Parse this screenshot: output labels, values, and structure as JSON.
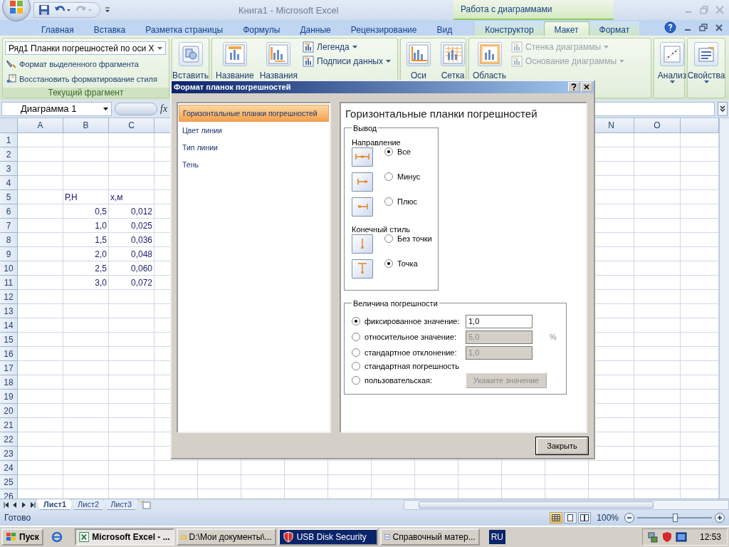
{
  "window": {
    "title": "Книга1 - Microsoft Excel",
    "context_group": "Работа с диаграммами"
  },
  "tabs": [
    {
      "label": "Главная",
      "selected": false,
      "contextual": false
    },
    {
      "label": "Вставка",
      "selected": false,
      "contextual": false
    },
    {
      "label": "Разметка страницы",
      "selected": false,
      "contextual": false
    },
    {
      "label": "Формулы",
      "selected": false,
      "contextual": false
    },
    {
      "label": "Данные",
      "selected": false,
      "contextual": false
    },
    {
      "label": "Рецензирование",
      "selected": false,
      "contextual": false
    },
    {
      "label": "Вид",
      "selected": false,
      "contextual": false
    },
    {
      "label": "Конструктор",
      "selected": false,
      "contextual": true
    },
    {
      "label": "Макет",
      "selected": true,
      "contextual": true
    },
    {
      "label": "Формат",
      "selected": false,
      "contextual": true
    }
  ],
  "ribbon": {
    "groups": [
      {
        "kind": "current",
        "selector": "Ряд1 Планки погрешностей по оси X",
        "commands": [
          "Формат выделенного фрагмента",
          "Восстановить форматирование стиля"
        ],
        "label": "Текущий фрагмент"
      },
      {
        "kind": "controls",
        "large": [
          {
            "label": "Вставить",
            "dropdown": false
          }
        ]
      },
      {
        "kind": "controls",
        "large": [
          {
            "label": "Название",
            "dropdown": false
          },
          {
            "label": "Названия",
            "dropdown": false
          }
        ],
        "small": [
          {
            "label": "Легенда",
            "dropdown": true,
            "disabled": false
          },
          {
            "label": "Подписи данных",
            "dropdown": true,
            "disabled": false
          }
        ]
      },
      {
        "kind": "controls",
        "large": [
          {
            "label": "Оси",
            "dropdown": false
          },
          {
            "label": "Сетка",
            "dropdown": false
          }
        ]
      },
      {
        "kind": "controls",
        "large": [
          {
            "label": "Область",
            "dropdown": false
          }
        ],
        "small": [
          {
            "label": "Стенка диаграммы",
            "dropdown": true,
            "disabled": true
          },
          {
            "label": "Основание диаграммы",
            "dropdown": true,
            "disabled": true
          }
        ]
      },
      {
        "kind": "controls",
        "large": [
          {
            "label": "Анализ",
            "dropdown": true
          }
        ]
      },
      {
        "kind": "controls",
        "large": [
          {
            "label": "Свойства",
            "dropdown": true
          }
        ]
      }
    ]
  },
  "formula_bar": {
    "name_box": "Диаграмма 1",
    "function_label": "fx"
  },
  "sheet": {
    "columns": [
      "A",
      "B",
      "C",
      "N",
      "O"
    ],
    "rows": [
      {
        "number": "1"
      },
      {
        "number": "2"
      },
      {
        "number": "3"
      },
      {
        "number": "4"
      },
      {
        "number": "5",
        "B": {
          "text": "Р,Н",
          "kind": "text"
        },
        "C": {
          "text": "х,м",
          "kind": "text"
        }
      },
      {
        "number": "6",
        "B": {
          "text": "0,5",
          "kind": "number"
        },
        "C": {
          "text": "0,012",
          "kind": "number"
        }
      },
      {
        "number": "7",
        "B": {
          "text": "1,0",
          "kind": "number"
        },
        "C": {
          "text": "0,025",
          "kind": "number"
        }
      },
      {
        "number": "8",
        "B": {
          "text": "1,5",
          "kind": "number"
        },
        "C": {
          "text": "0,036",
          "kind": "number"
        }
      },
      {
        "number": "9",
        "B": {
          "text": "2,0",
          "kind": "number"
        },
        "C": {
          "text": "0,048",
          "kind": "number"
        }
      },
      {
        "number": "10",
        "B": {
          "text": "2,5",
          "kind": "number"
        },
        "C": {
          "text": "0,060",
          "kind": "number"
        }
      },
      {
        "number": "11",
        "B": {
          "text": "3,0",
          "kind": "number"
        },
        "C": {
          "text": "0,072",
          "kind": "number"
        }
      },
      {
        "number": "12"
      },
      {
        "number": "13"
      },
      {
        "number": "14"
      },
      {
        "number": "15"
      },
      {
        "number": "16"
      },
      {
        "number": "17"
      },
      {
        "number": "18"
      },
      {
        "number": "19"
      },
      {
        "number": "20"
      },
      {
        "number": "21"
      },
      {
        "number": "22"
      },
      {
        "number": "23"
      },
      {
        "number": "24"
      },
      {
        "number": "25"
      },
      {
        "number": "26"
      }
    ]
  },
  "sheet_tabs": [
    {
      "label": "Лист1",
      "selected": true
    },
    {
      "label": "Лист2",
      "selected": false
    },
    {
      "label": "Лист3",
      "selected": false
    }
  ],
  "status_bar": {
    "status": "Готово",
    "views": [
      {
        "selected": true
      },
      {
        "selected": false
      },
      {
        "selected": false
      }
    ],
    "zoom": "100%",
    "zoom_slider": {
      "level": 0.5
    }
  },
  "taskbar": {
    "start": "Пуск",
    "tasks": [
      {
        "label": "Microsoft Excel - ...",
        "selected": true,
        "flashing": false
      },
      {
        "label": "D:\\Мои документы\\...",
        "selected": false,
        "flashing": false
      },
      {
        "label": "USB Disk Security",
        "selected": false,
        "flashing": true
      },
      {
        "label": "Справочный матер...",
        "selected": false,
        "flashing": false
      }
    ],
    "language": "RU",
    "clock": "12:53"
  },
  "dialog": {
    "title": "Формат планок погрешностей",
    "nav": [
      {
        "label": "Горизонтальные планки погрешностей",
        "selected": true
      },
      {
        "label": "Цвет линии",
        "selected": false
      },
      {
        "label": "Тип линии",
        "selected": false
      },
      {
        "label": "Тень",
        "selected": false
      }
    ],
    "heading": "Горизонтальные планки погрешностей",
    "display": {
      "legend": "Вывод",
      "direction_label": "Направление",
      "directions": [
        {
          "label": "Все",
          "selected": true
        },
        {
          "label": "Минус",
          "selected": false
        },
        {
          "label": "Плюс",
          "selected": false
        }
      ],
      "end_style_label": "Конечный стиль",
      "end_styles": [
        {
          "label": "Без точки",
          "selected": false
        },
        {
          "label": "Точка",
          "selected": true
        }
      ]
    },
    "amount": {
      "legend": "Величина погрешности",
      "options": [
        {
          "kind": "field",
          "label": "фиксированное значение:",
          "selected": true,
          "value": "1,0",
          "disabled": false
        },
        {
          "kind": "field",
          "label": "относительное значение:",
          "selected": false,
          "value": "5,0",
          "disabled": true,
          "unit": "%"
        },
        {
          "kind": "field",
          "label": "стандартное отклонение:",
          "selected": false,
          "value": "1,0",
          "disabled": true
        },
        {
          "kind": "plain",
          "label": "стандартная погрешность",
          "selected": false
        },
        {
          "kind": "button",
          "label": "пользовательская:",
          "selected": false,
          "button": "Укажите значение",
          "disabled": true
        }
      ]
    },
    "close_button": "Закрыть"
  }
}
